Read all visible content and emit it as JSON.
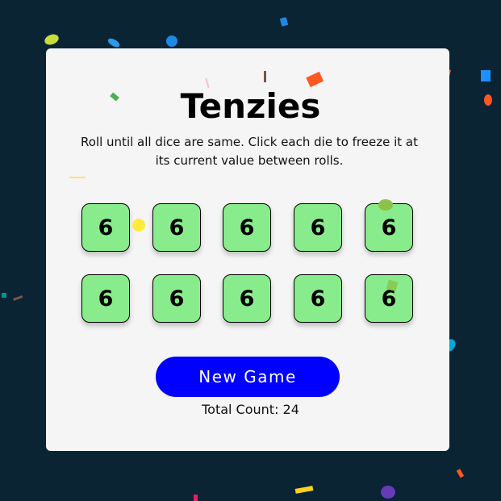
{
  "game": {
    "title": "Tenzies",
    "instructions": "Roll until all dice are same. Click each die to freeze it at its current value between rolls.",
    "dice": [
      {
        "value": "6",
        "held": true
      },
      {
        "value": "6",
        "held": true
      },
      {
        "value": "6",
        "held": true
      },
      {
        "value": "6",
        "held": true
      },
      {
        "value": "6",
        "held": true
      },
      {
        "value": "6",
        "held": true
      },
      {
        "value": "6",
        "held": true
      },
      {
        "value": "6",
        "held": true
      },
      {
        "value": "6",
        "held": true
      },
      {
        "value": "6",
        "held": true
      }
    ],
    "new_game_label": "New Game",
    "count_label": "Total Count: ",
    "count_value": "24"
  },
  "colors": {
    "background": "#0b2434",
    "card": "#f5f5f5",
    "held_die": "#89ec8c",
    "button": "#0000ff"
  }
}
